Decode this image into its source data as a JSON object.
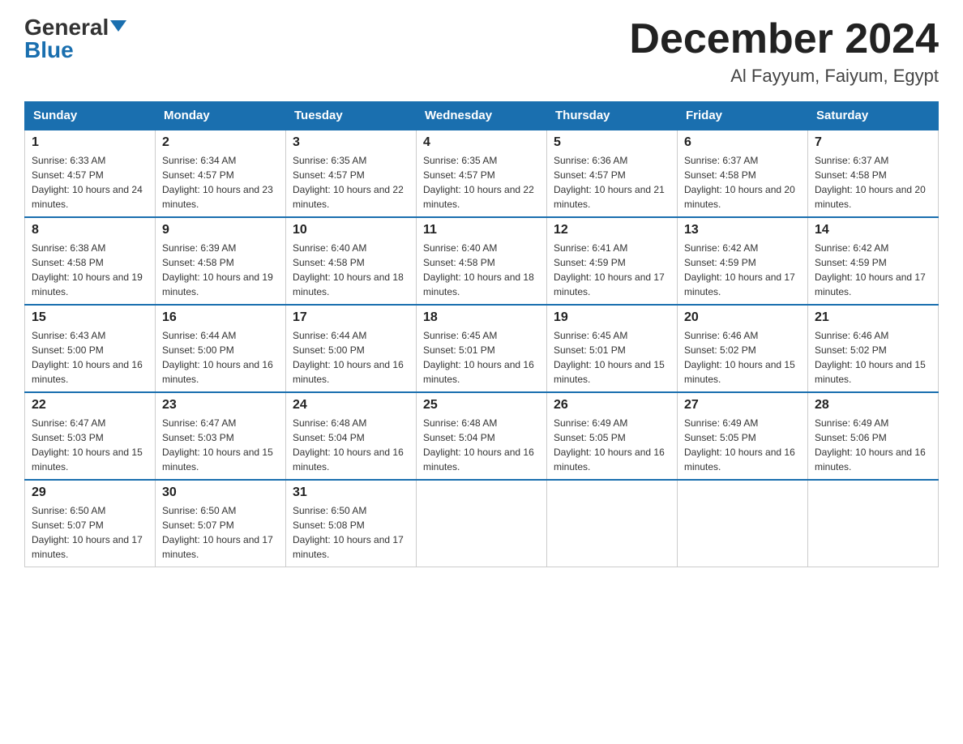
{
  "logo": {
    "general": "General",
    "blue": "Blue"
  },
  "title": "December 2024",
  "subtitle": "Al Fayyum, Faiyum, Egypt",
  "headers": [
    "Sunday",
    "Monday",
    "Tuesday",
    "Wednesday",
    "Thursday",
    "Friday",
    "Saturday"
  ],
  "weeks": [
    [
      {
        "day": "1",
        "sunrise": "6:33 AM",
        "sunset": "4:57 PM",
        "daylight": "10 hours and 24 minutes."
      },
      {
        "day": "2",
        "sunrise": "6:34 AM",
        "sunset": "4:57 PM",
        "daylight": "10 hours and 23 minutes."
      },
      {
        "day": "3",
        "sunrise": "6:35 AM",
        "sunset": "4:57 PM",
        "daylight": "10 hours and 22 minutes."
      },
      {
        "day": "4",
        "sunrise": "6:35 AM",
        "sunset": "4:57 PM",
        "daylight": "10 hours and 22 minutes."
      },
      {
        "day": "5",
        "sunrise": "6:36 AM",
        "sunset": "4:57 PM",
        "daylight": "10 hours and 21 minutes."
      },
      {
        "day": "6",
        "sunrise": "6:37 AM",
        "sunset": "4:58 PM",
        "daylight": "10 hours and 20 minutes."
      },
      {
        "day": "7",
        "sunrise": "6:37 AM",
        "sunset": "4:58 PM",
        "daylight": "10 hours and 20 minutes."
      }
    ],
    [
      {
        "day": "8",
        "sunrise": "6:38 AM",
        "sunset": "4:58 PM",
        "daylight": "10 hours and 19 minutes."
      },
      {
        "day": "9",
        "sunrise": "6:39 AM",
        "sunset": "4:58 PM",
        "daylight": "10 hours and 19 minutes."
      },
      {
        "day": "10",
        "sunrise": "6:40 AM",
        "sunset": "4:58 PM",
        "daylight": "10 hours and 18 minutes."
      },
      {
        "day": "11",
        "sunrise": "6:40 AM",
        "sunset": "4:58 PM",
        "daylight": "10 hours and 18 minutes."
      },
      {
        "day": "12",
        "sunrise": "6:41 AM",
        "sunset": "4:59 PM",
        "daylight": "10 hours and 17 minutes."
      },
      {
        "day": "13",
        "sunrise": "6:42 AM",
        "sunset": "4:59 PM",
        "daylight": "10 hours and 17 minutes."
      },
      {
        "day": "14",
        "sunrise": "6:42 AM",
        "sunset": "4:59 PM",
        "daylight": "10 hours and 17 minutes."
      }
    ],
    [
      {
        "day": "15",
        "sunrise": "6:43 AM",
        "sunset": "5:00 PM",
        "daylight": "10 hours and 16 minutes."
      },
      {
        "day": "16",
        "sunrise": "6:44 AM",
        "sunset": "5:00 PM",
        "daylight": "10 hours and 16 minutes."
      },
      {
        "day": "17",
        "sunrise": "6:44 AM",
        "sunset": "5:00 PM",
        "daylight": "10 hours and 16 minutes."
      },
      {
        "day": "18",
        "sunrise": "6:45 AM",
        "sunset": "5:01 PM",
        "daylight": "10 hours and 16 minutes."
      },
      {
        "day": "19",
        "sunrise": "6:45 AM",
        "sunset": "5:01 PM",
        "daylight": "10 hours and 15 minutes."
      },
      {
        "day": "20",
        "sunrise": "6:46 AM",
        "sunset": "5:02 PM",
        "daylight": "10 hours and 15 minutes."
      },
      {
        "day": "21",
        "sunrise": "6:46 AM",
        "sunset": "5:02 PM",
        "daylight": "10 hours and 15 minutes."
      }
    ],
    [
      {
        "day": "22",
        "sunrise": "6:47 AM",
        "sunset": "5:03 PM",
        "daylight": "10 hours and 15 minutes."
      },
      {
        "day": "23",
        "sunrise": "6:47 AM",
        "sunset": "5:03 PM",
        "daylight": "10 hours and 15 minutes."
      },
      {
        "day": "24",
        "sunrise": "6:48 AM",
        "sunset": "5:04 PM",
        "daylight": "10 hours and 16 minutes."
      },
      {
        "day": "25",
        "sunrise": "6:48 AM",
        "sunset": "5:04 PM",
        "daylight": "10 hours and 16 minutes."
      },
      {
        "day": "26",
        "sunrise": "6:49 AM",
        "sunset": "5:05 PM",
        "daylight": "10 hours and 16 minutes."
      },
      {
        "day": "27",
        "sunrise": "6:49 AM",
        "sunset": "5:05 PM",
        "daylight": "10 hours and 16 minutes."
      },
      {
        "day": "28",
        "sunrise": "6:49 AM",
        "sunset": "5:06 PM",
        "daylight": "10 hours and 16 minutes."
      }
    ],
    [
      {
        "day": "29",
        "sunrise": "6:50 AM",
        "sunset": "5:07 PM",
        "daylight": "10 hours and 17 minutes."
      },
      {
        "day": "30",
        "sunrise": "6:50 AM",
        "sunset": "5:07 PM",
        "daylight": "10 hours and 17 minutes."
      },
      {
        "day": "31",
        "sunrise": "6:50 AM",
        "sunset": "5:08 PM",
        "daylight": "10 hours and 17 minutes."
      },
      null,
      null,
      null,
      null
    ]
  ]
}
